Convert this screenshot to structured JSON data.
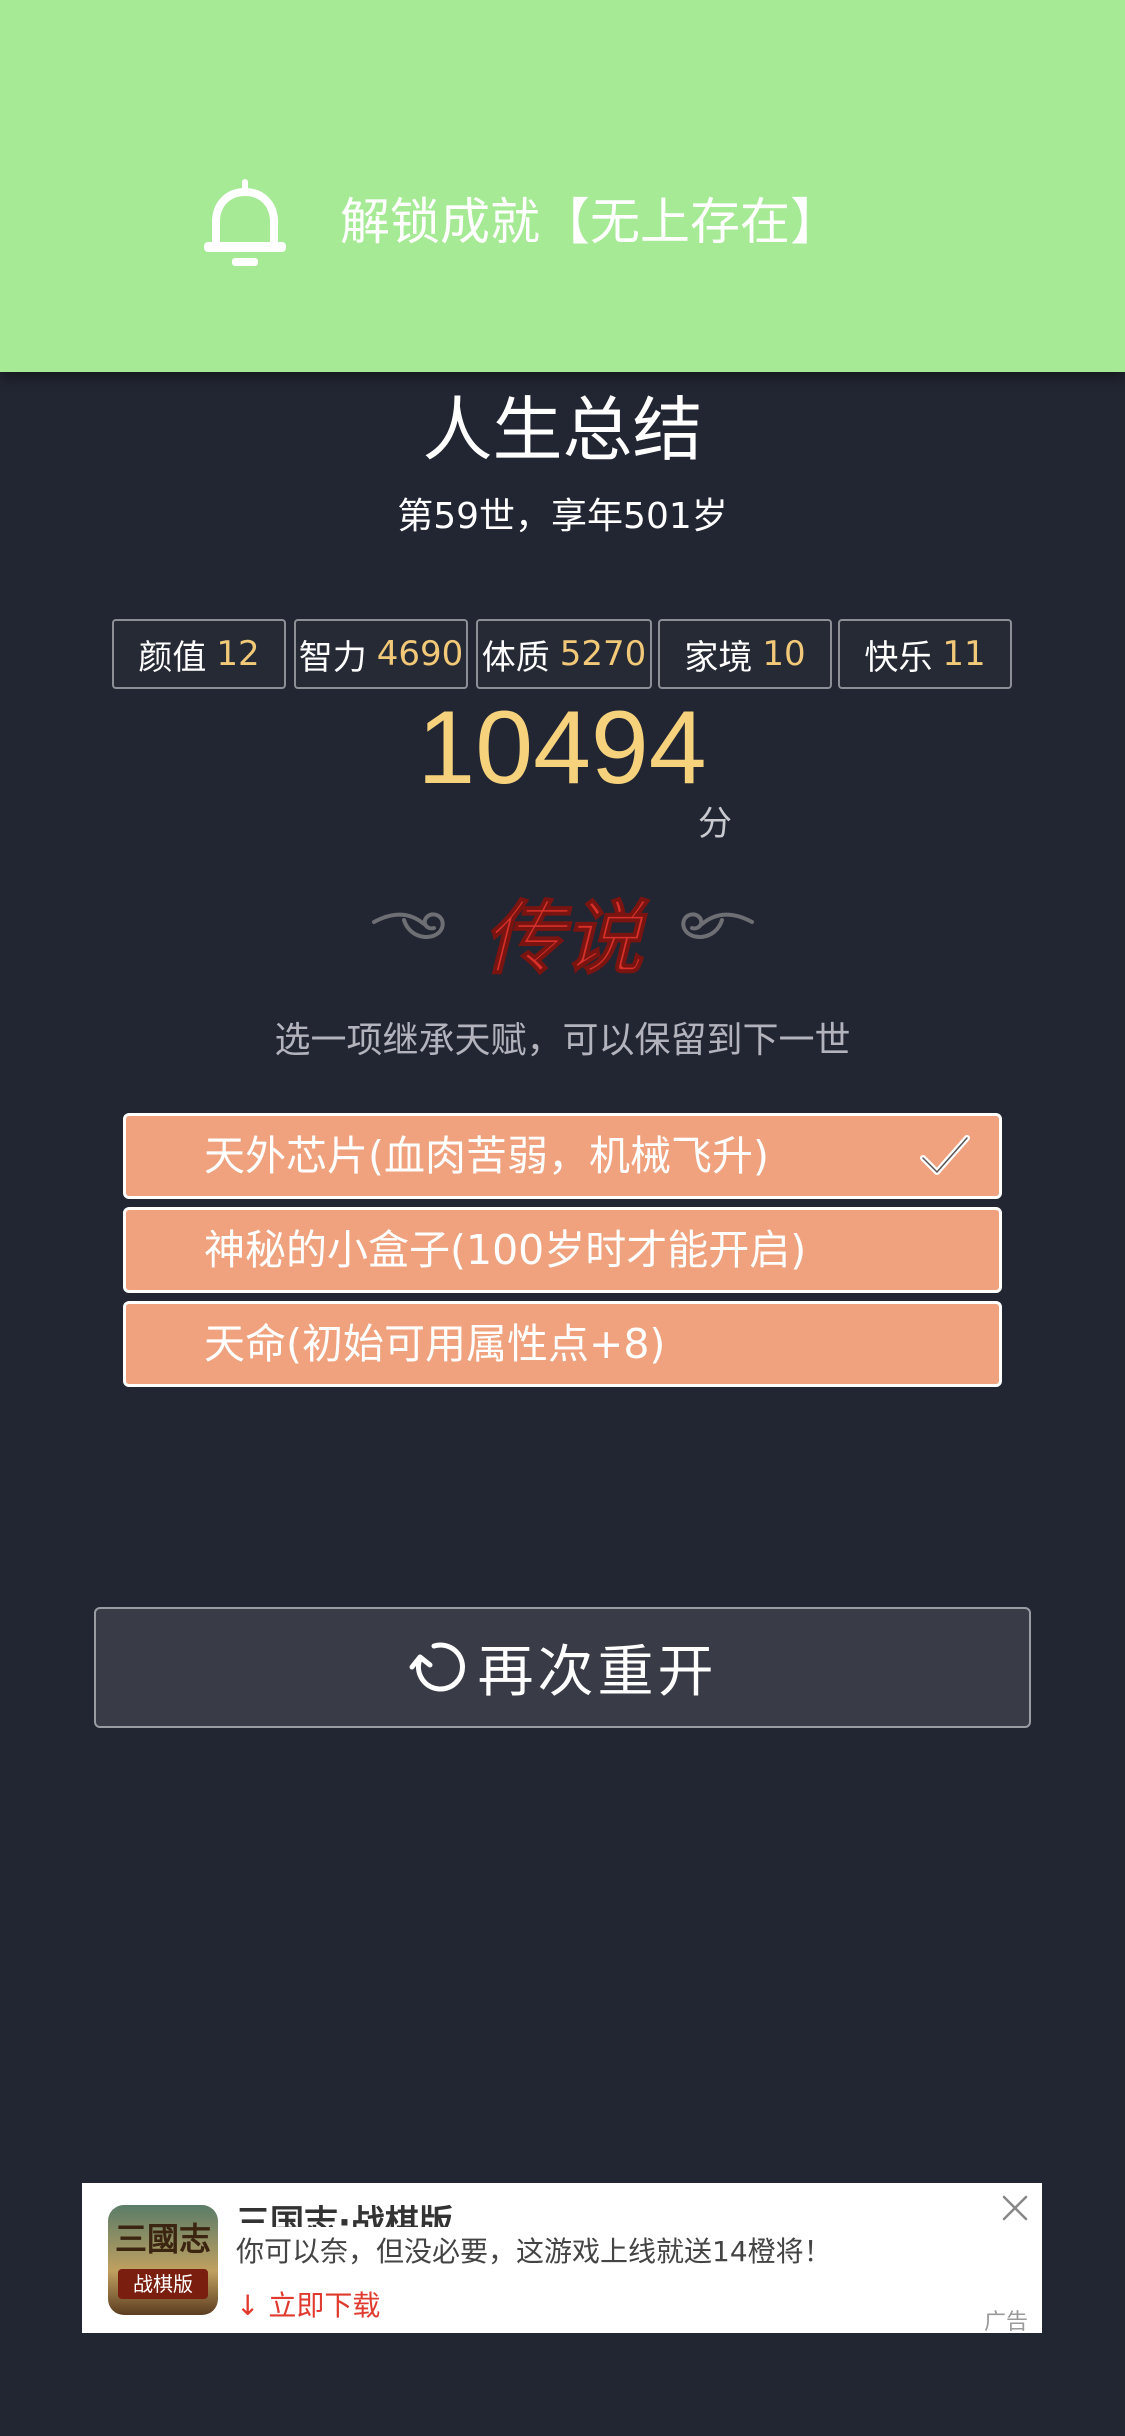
{
  "notification": {
    "icon": "bell-icon",
    "text": "解锁成就【无上存在】"
  },
  "summary": {
    "title": "人生总结",
    "subtitle": "第59世，享年501岁"
  },
  "stats": [
    {
      "label": "颜值",
      "value": "12"
    },
    {
      "label": "智力",
      "value": "4690"
    },
    {
      "label": "体质",
      "value": "5270"
    },
    {
      "label": "家境",
      "value": "10"
    },
    {
      "label": "快乐",
      "value": "11"
    }
  ],
  "score": {
    "value": "10494",
    "unit": "分",
    "rank": "传说"
  },
  "inherit": {
    "hint": "选一项继承天赋，可以保留到下一世",
    "talents": [
      {
        "name": "天外芯片(血肉苦弱，机械飞升)",
        "selected": true
      },
      {
        "name": "神秘的小盒子(100岁时才能开启)",
        "selected": false
      },
      {
        "name": "天命(初始可用属性点+8)",
        "selected": false
      }
    ]
  },
  "restart": {
    "label": "再次重开"
  },
  "ad": {
    "title": "三国志·战棋版",
    "logo_text_top": "三國志",
    "logo_text_bottom": "战棋版",
    "description": "你可以奈，但没必要，这游戏上线就送14橙将！",
    "download_label": "立即下载",
    "ad_mark": "广告"
  },
  "colors": {
    "banner": "#a6ea95",
    "background": "#222632",
    "talent": "#efa27d",
    "score": "#f5d27b",
    "rank": "#d8302a"
  }
}
